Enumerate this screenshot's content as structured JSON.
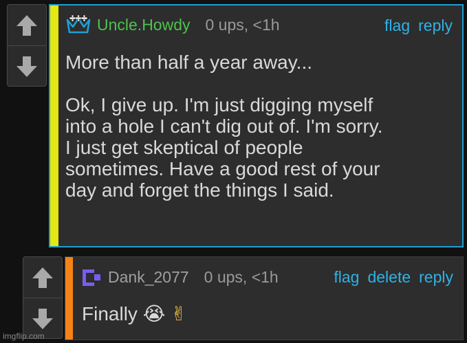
{
  "colors": {
    "background": "#111111",
    "panel": "#2d2d2d",
    "link": "#2fb2e6",
    "username_green": "#4cc34c",
    "username_gray": "#a0a0a0",
    "accent_yellow": "#e5e812",
    "accent_orange": "#f58216",
    "outline_blue": "#1ea0d6"
  },
  "comments": [
    {
      "username": "Uncle.Howdy",
      "badge_icon": "crown-icon",
      "stats": "0 ups, <1h",
      "actions": {
        "flag": "flag",
        "reply": "reply"
      },
      "body": "More than half a year away...\n\nOk, I give up. I'm just digging myself\ninto a hole I can't dig out of. I'm sorry.\nI just get skeptical of people\nsometimes. Have a good rest of your\nday and forget the things I said.",
      "vote_icons": [
        "upvote-arrow-icon",
        "downvote-arrow-icon"
      ]
    },
    {
      "username": "Dank_2077",
      "badge_icon": "purple-pixel-icon",
      "stats": "0 ups, <1h",
      "actions": {
        "flag": "flag",
        "delete": "delete",
        "reply": "reply"
      },
      "body": "Finally",
      "emojis": [
        "😭",
        "✌"
      ],
      "vote_icons": [
        "upvote-arrow-icon",
        "downvote-arrow-icon"
      ]
    }
  ],
  "watermark": "imgflip.com"
}
